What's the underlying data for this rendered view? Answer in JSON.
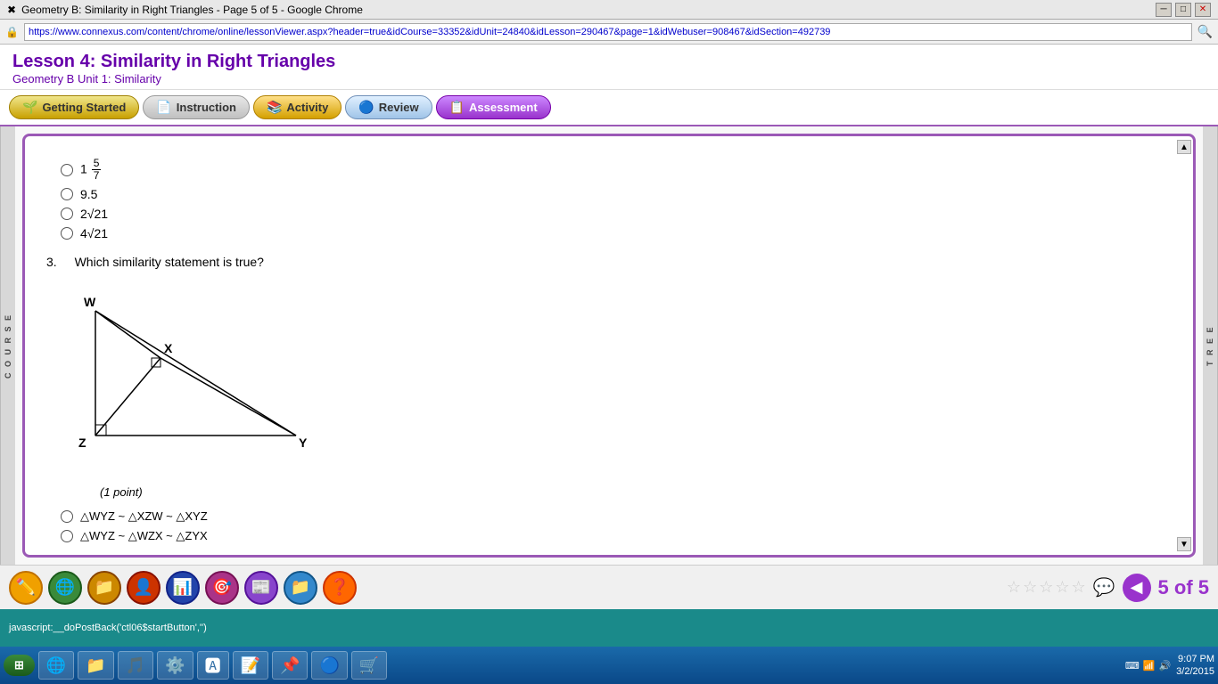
{
  "window": {
    "title": "Geometry B: Similarity in Right Triangles - Page 5 of 5 - Google Chrome",
    "url": "https://www.connexus.com/content/chrome/online/lessonViewer.aspx?header=true&idCourse=33352&idUnit=24840&idLesson=290467&page=1&idWebuser=908467&idSection=492739"
  },
  "lesson": {
    "title": "Lesson 4: Similarity in Right Triangles",
    "subtitle": "Geometry B  Unit 1: Similarity"
  },
  "tabs": {
    "getting_started": "Getting Started",
    "instruction": "Instruction",
    "activity": "Activity",
    "review": "Review",
    "assessment": "Assessment"
  },
  "content": {
    "question3": {
      "number": "3.",
      "text": "Which similarity statement is true?",
      "point_label": "(1 point)",
      "vertices": {
        "W": "W",
        "X": "X",
        "Y": "Y",
        "Z": "Z"
      }
    },
    "answer_options_q2": [
      "1 5/7",
      "9.5",
      "2√21",
      "4√21"
    ],
    "answer_options_q3": [
      "△WYZ ~ △XZW ~ △XYZ",
      "△WYZ ~ △WZX ~ △ZYX"
    ]
  },
  "pagination": {
    "current": "5",
    "total": "5",
    "label": "5 of 5"
  },
  "side_labels": {
    "course": "C O U R S E",
    "tree": "T R E E"
  },
  "status_bar": {
    "text": "javascript:__doPostBack('ctl06$startButton','')"
  },
  "taskbar": {
    "time": "9:07 PM",
    "date": "3/2/2015"
  },
  "stars": [
    "empty",
    "empty",
    "empty",
    "empty",
    "empty"
  ]
}
